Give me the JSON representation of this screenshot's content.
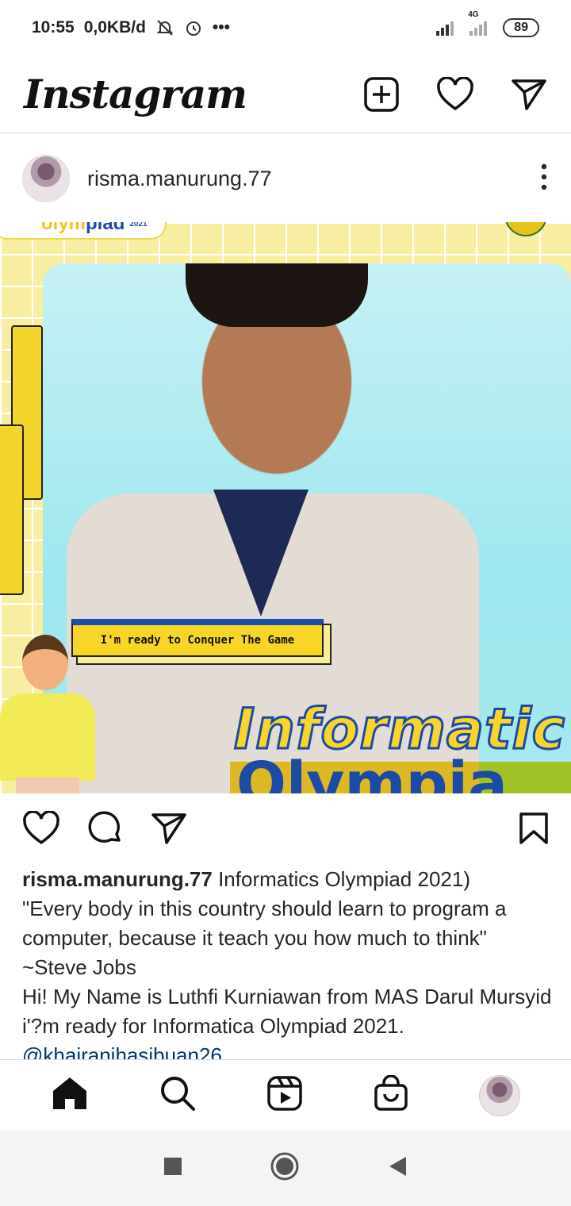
{
  "status_bar": {
    "time": "10:55",
    "speed": "0,0KB/d",
    "dots": "•••",
    "network": "4G",
    "battery": "89"
  },
  "header": {
    "logo": "Instagram",
    "icons": [
      "new-post-icon",
      "heart-icon",
      "direct-message-icon"
    ]
  },
  "post": {
    "username": "risma.manurung.77",
    "image": {
      "badge_part1": "olym",
      "badge_part2": "piad",
      "badge_year": "2021",
      "bubble_text": "I'm ready to Conquer The Game",
      "title_line1": "Informatic",
      "title_line2": "Olympia"
    },
    "caption": {
      "username": "risma.manurung.77",
      "line1": " Informatics Olympiad 2021)",
      "line2": "\"Every body in this country should learn to program a computer, because it teach you how much to think\"",
      "line3": "~Steve Jobs",
      "line4": "Hi! My Name is Luthfi Kurniawan from MAS Darul Mursyid i'?m ready for Informatica Olympiad 2021.",
      "mention": "@khairanihasibuan26"
    }
  },
  "bottom_nav": {
    "items": [
      "home-icon",
      "search-icon",
      "reels-icon",
      "shop-icon",
      "profile-avatar"
    ]
  },
  "colors": {
    "brand_blue": "#1d4aa6",
    "brand_yellow": "#f8d529",
    "mention": "#00376b"
  }
}
